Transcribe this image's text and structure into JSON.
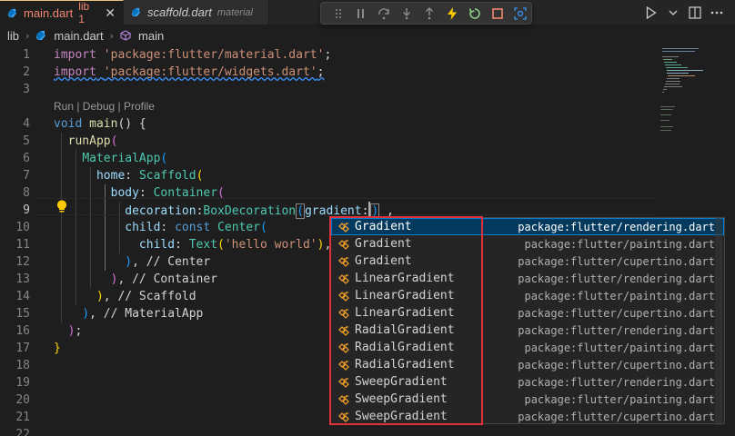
{
  "tabs": [
    {
      "name": "main.dart",
      "badge": "lib 1",
      "close": "✕"
    },
    {
      "name": "scaffold.dart",
      "sub": "material"
    }
  ],
  "breadcrumb": [
    "lib",
    "main.dart",
    "main"
  ],
  "codelens": "Run | Debug | Profile",
  "line_numbers": [
    "1",
    "2",
    "3",
    "4",
    "5",
    "6",
    "7",
    "8",
    "9",
    "10",
    "11",
    "12",
    "13",
    "14",
    "15",
    "16",
    "17",
    "18",
    "19",
    "20",
    "21",
    "22"
  ],
  "code": {
    "l1_kw": "import",
    "l1_str": "'package:flutter/material.dart'",
    "l1_end": ";",
    "l2_kw": "import",
    "l2_str": "'package:flutter/widgets.dart'",
    "l2_end": ";",
    "l4_kw": "void",
    "l4_fn": "main",
    "l4_rest": "() {",
    "l5_fn": "runApp",
    "l5_p": "(",
    "l6_cls": "MaterialApp",
    "l6_p": "(",
    "l7_prop": "home",
    "l7_colon": ": ",
    "l7_cls": "Scaffold",
    "l7_p": "(",
    "l8_prop": "body",
    "l8_colon": ": ",
    "l8_cls": "Container",
    "l8_p": "(",
    "l9_prop": "decoration",
    "l9_colon": ":",
    "l9_cls": "BoxDecoration",
    "l9_p": "(",
    "l9_prop2": "gradient",
    "l9_colon2": ":",
    "l9_close": ")",
    "l9_end": " ,",
    "l10_prop": "child",
    "l10_colon": ": ",
    "l10_kw": "const",
    "l10_cls": "Center",
    "l10_p": "(",
    "l11_prop": "child",
    "l11_colon": ": ",
    "l11_cls": "Text",
    "l11_p": "(",
    "l11_str": "'hello world'",
    "l11_close": ")",
    "l11_end": ",",
    "l12_p": ")",
    "l12_cmt": ", // Center",
    "l13_p": ")",
    "l13_cmt": ", // Container",
    "l14_p": ")",
    "l14_cmt": ", // Scaffold",
    "l15_p": ")",
    "l15_cmt": ", // MaterialApp",
    "l16_p": ")",
    "l16_end": ";",
    "l17": "}"
  },
  "suggestions": [
    {
      "label": "Gradient",
      "detail": "package:flutter/rendering.dart"
    },
    {
      "label": "Gradient",
      "detail": "package:flutter/painting.dart"
    },
    {
      "label": "Gradient",
      "detail": "package:flutter/cupertino.dart"
    },
    {
      "label": "LinearGradient",
      "detail": "package:flutter/rendering.dart"
    },
    {
      "label": "LinearGradient",
      "detail": "package:flutter/painting.dart"
    },
    {
      "label": "LinearGradient",
      "detail": "package:flutter/cupertino.dart"
    },
    {
      "label": "RadialGradient",
      "detail": "package:flutter/rendering.dart"
    },
    {
      "label": "RadialGradient",
      "detail": "package:flutter/painting.dart"
    },
    {
      "label": "RadialGradient",
      "detail": "package:flutter/cupertino.dart"
    },
    {
      "label": "SweepGradient",
      "detail": "package:flutter/rendering.dart"
    },
    {
      "label": "SweepGradient",
      "detail": "package:flutter/painting.dart"
    },
    {
      "label": "SweepGradient",
      "detail": "package:flutter/cupertino.dart"
    }
  ],
  "colors": {
    "accent": "#007fd4",
    "highlight_box": "#e0303a",
    "error": "#f48771"
  },
  "icons": [
    "dart-file-icon",
    "debug-drag-icon",
    "pause-icon",
    "step-over-icon",
    "step-into-icon",
    "step-out-icon",
    "hot-reload-icon",
    "restart-icon",
    "stop-icon",
    "devtools-icon",
    "run-icon",
    "split-editor-icon",
    "more-icon",
    "lightbulb-icon",
    "class-icon"
  ]
}
